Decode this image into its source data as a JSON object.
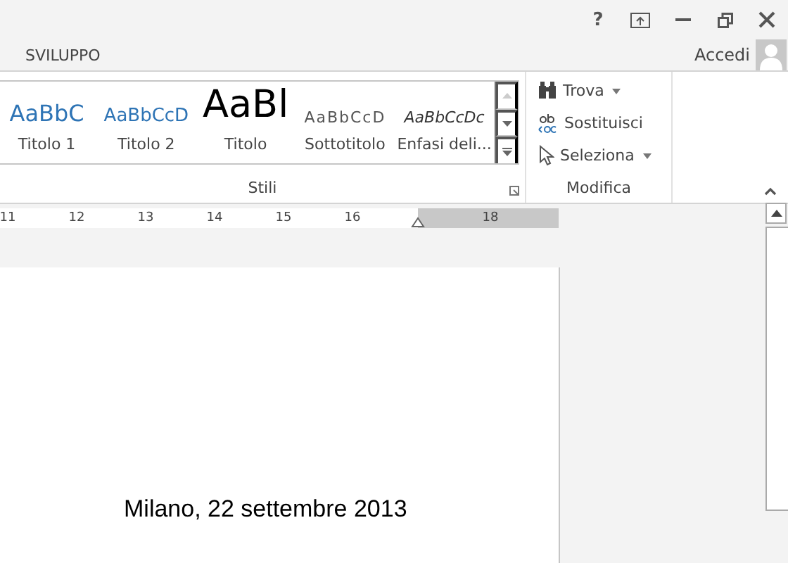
{
  "window": {
    "controls": [
      "?"
    ]
  },
  "ribbon_tabs": [
    {
      "label": "SVILUPPO",
      "selected": false
    }
  ],
  "account": {
    "label": "Accedi"
  },
  "styles_group": {
    "title": "Stili",
    "items": [
      {
        "preview": "AaBbC",
        "label": "Titolo 1",
        "kind": "heading1"
      },
      {
        "preview": "AaBbCcD",
        "label": "Titolo 2",
        "kind": "heading2"
      },
      {
        "preview": "AaBl",
        "label": "Titolo",
        "kind": "title"
      },
      {
        "preview": "AaBbCcD",
        "label": "Sottotitolo",
        "kind": "subtitle"
      },
      {
        "preview": "AaBbCcDc",
        "label": "Enfasi deli...",
        "kind": "emphasis"
      }
    ]
  },
  "edit_group": {
    "title": "Modifica",
    "items": [
      {
        "label": "Trova",
        "kind": "find",
        "dropdown": true
      },
      {
        "label": "Sostituisci",
        "kind": "replace",
        "dropdown": false
      },
      {
        "label": "Seleziona",
        "kind": "select",
        "dropdown": true
      }
    ]
  },
  "ruler": {
    "labels": [
      "11",
      "12",
      "13",
      "14",
      "15",
      "16",
      "18"
    ]
  },
  "document": {
    "lines": [
      "Milano, 22 settembre 2013"
    ]
  }
}
